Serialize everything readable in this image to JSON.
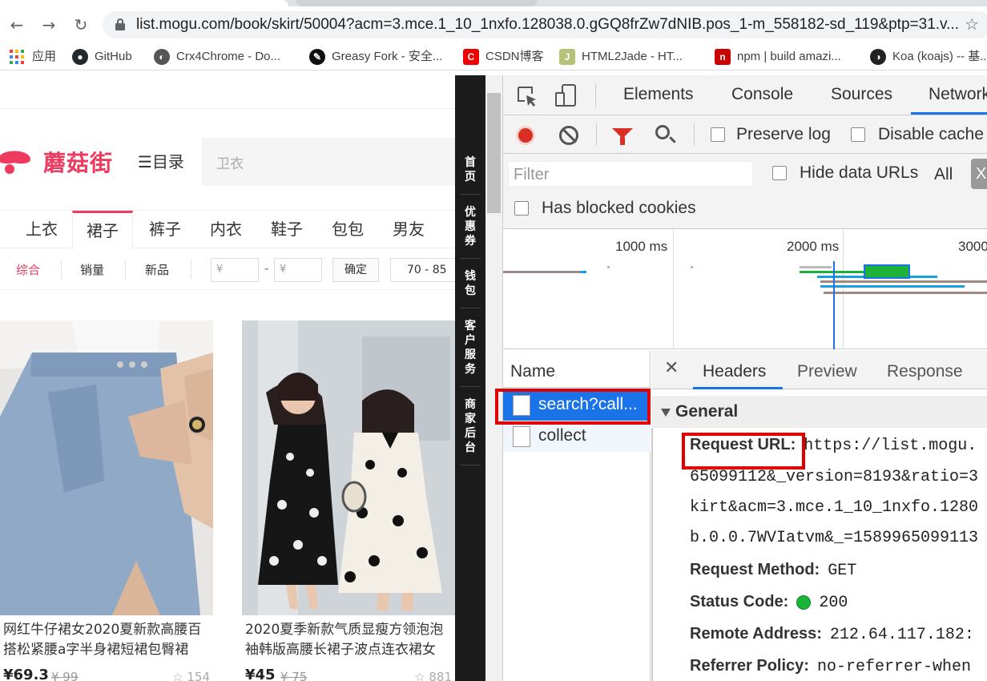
{
  "browser": {
    "url": "list.mogu.com/book/skirt/50004?acm=3.mce.1_10_1nxfo.128038.0.gGQ8frZw7dNIB.pos_1-m_558182-sd_119&ptp=31.v...",
    "bookmarks": [
      {
        "label": "应用",
        "icon": "apps-grid-icon"
      },
      {
        "label": "GitHub",
        "icon": "github-icon"
      },
      {
        "label": "Crx4Chrome - Do...",
        "icon": "crx4chrome-icon"
      },
      {
        "label": "Greasy Fork - 安全...",
        "icon": "greasyfork-icon"
      },
      {
        "label": "CSDN博客",
        "icon": "csdn-icon"
      },
      {
        "label": "HTML2Jade - HT...",
        "icon": "html2jade-icon"
      },
      {
        "label": "npm | build amazi...",
        "icon": "npm-icon"
      },
      {
        "label": "Koa (koajs) -- 基...",
        "icon": "koa-icon"
      }
    ]
  },
  "page": {
    "logo_text": "蘑菇街",
    "menu_label": "目录",
    "search_placeholder": "卫衣",
    "categories": [
      "上衣",
      "裙子",
      "裤子",
      "内衣",
      "鞋子",
      "包包",
      "男友"
    ],
    "filters": {
      "sort_comprehensive": "综合",
      "sort_sales": "销量",
      "sort_new": "新品",
      "price_min_placeholder": "¥",
      "price_max_placeholder": "¥",
      "dash": "-",
      "confirm": "确定",
      "range": "70 - 85"
    },
    "products": [
      {
        "title": "网红牛仔裙女2020夏新款高腰百搭松紧腰a字半身裙短裙包臀裙",
        "price": "¥69.3",
        "orig": "¥ 99",
        "fav": "154"
      },
      {
        "title": "2020夏季新款气质显瘦方领泡泡袖韩版高腰长裙子波点连衣裙女",
        "price": "¥45",
        "orig": "¥ 75",
        "fav": "881"
      }
    ],
    "sidebar": [
      "首页",
      "优惠券",
      "钱包",
      "客户服务",
      "商家后台"
    ]
  },
  "devtools": {
    "tabs": [
      "Elements",
      "Console",
      "Sources",
      "Network"
    ],
    "toolbar": {
      "preserve_log": "Preserve log",
      "disable_cache": "Disable cache"
    },
    "filter_placeholder": "Filter",
    "hide_data_urls": "Hide data URLs",
    "all_label": "All",
    "xhr_chip": "X",
    "has_blocked_cookies": "Has blocked cookies",
    "overview_ticks": [
      "1000 ms",
      "2000 ms",
      "3000"
    ],
    "name_header": "Name",
    "requests": [
      "search?call...",
      "collect"
    ],
    "detail_tabs": [
      "Headers",
      "Preview",
      "Response"
    ],
    "general_label": "General",
    "request_url_key": "Request URL:",
    "request_url_lines": [
      "https://list.mogu.",
      "65099112&_version=8193&ratio=3",
      "kirt&acm=3.mce.1_10_1nxfo.1280",
      "b.0.0.7WVIatvm&_=1589965099113"
    ],
    "method_key": "Request Method:",
    "method_val": "GET",
    "status_key": "Status Code:",
    "status_val": "200",
    "remote_key": "Remote Address:",
    "remote_val": "212.64.117.182:",
    "referrer_key": "Referrer Policy:",
    "referrer_val": "no-referrer-when"
  },
  "colors": {
    "brand": "#ee3a5e",
    "highlight": "#e00000",
    "selection": "#1a73e8",
    "status_ok": "#1db33b"
  }
}
